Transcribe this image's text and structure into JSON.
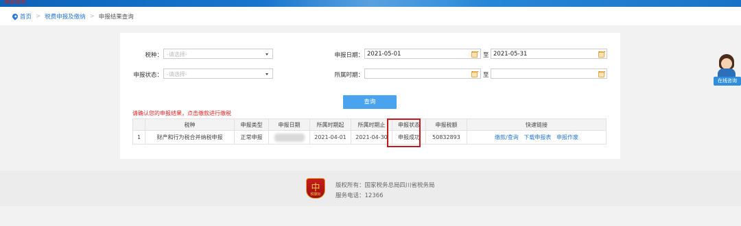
{
  "topbar": {
    "logo_text": "国家税务"
  },
  "breadcrumb": {
    "home": "首页",
    "section": "税费申报及缴纳",
    "current": "申报结果查询",
    "sep": ">"
  },
  "form": {
    "tax_type_label": "税种：",
    "tax_type_placeholder": "-请选择-",
    "status_label": "申报状态：",
    "status_placeholder": "-请选择-",
    "date_label": "申报日期：",
    "date_from": "2021-05-01",
    "date_to": "2021-05-31",
    "period_label": "所属时期：",
    "period_from": "",
    "period_to": "",
    "to_label": "至",
    "query_button": "查询"
  },
  "notice": "请确认您的申报结果，点击缴款进行缴税",
  "table": {
    "headers": [
      "",
      "税种",
      "申报类型",
      "申报日期",
      "所属时期起",
      "所属时期止",
      "申报状态",
      "申报税额",
      "快速链接"
    ],
    "rows": [
      {
        "index": "1",
        "tax_type": "财产和行为税合并纳税申报",
        "declare_type": "正常申报",
        "declare_date": "",
        "period_start": "2021-04-01",
        "period_end": "2021-04-30",
        "status": "申报成功",
        "amount": "50832893",
        "links": [
          "缴款/查询",
          "下载申报表",
          "申报作废"
        ]
      }
    ]
  },
  "footer": {
    "copyright": "版权所有：国家税务总局四川省税务局",
    "phone": "服务电话：12366",
    "logo_symbol": "中",
    "logo_text": "税徽标"
  },
  "customer_service": {
    "label": "在线咨询"
  },
  "colors": {
    "accent": "#4aa3ee",
    "link": "#2878d6",
    "highlight": "#c3181f",
    "notice": "#e02424"
  }
}
